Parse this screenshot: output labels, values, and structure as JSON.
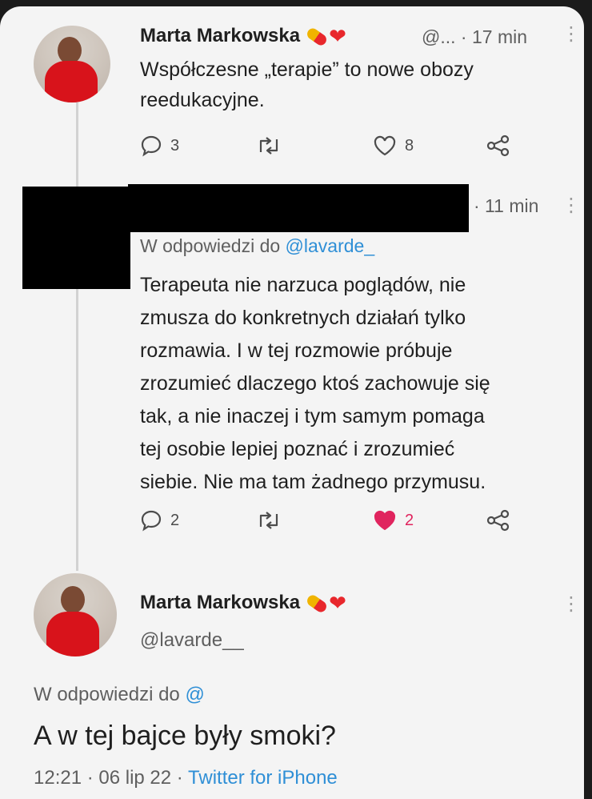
{
  "tweet1": {
    "name": "Marta Markowska",
    "handle_short": "@...",
    "time": "· 17 min",
    "text_line1": "Współczesne „terapie” to nowe obozy",
    "text_line2": "reedukacyjne.",
    "replies": "3",
    "likes": "8"
  },
  "tweet2": {
    "time": "· 11 min",
    "reply_prefix": "W odpowiedzi do ",
    "reply_handle": "@lavarde_",
    "lines": [
      "Terapeuta nie narzuca poglądów, nie",
      "zmusza do konkretnych działań tylko",
      "rozmawia. I w tej rozmowie próbuje",
      "zrozumieć dlaczego ktoś zachowuje się",
      "tak, a nie inaczej i tym samym pomaga",
      "tej osobie lepiej poznać i zrozumieć",
      "siebie. Nie ma tam żadnego przymusu."
    ],
    "replies": "2",
    "likes": "2",
    "liked_color": "#e0245e"
  },
  "tweet3": {
    "name": "Marta Markowska",
    "handle": "@lavarde__",
    "reply_prefix": "W odpowiedzi do ",
    "reply_handle": "@",
    "text": "A w tej bajce były smoki?",
    "time": "12:21 · 06 lip 22 · ",
    "source": "Twitter for iPhone"
  },
  "icons": {
    "reply": "reply-bubble-icon",
    "retweet": "retweet-icon",
    "like": "heart-icon",
    "share": "share-icon",
    "more": "more-vertical-icon"
  },
  "colors": {
    "link": "#2f8fd6",
    "like_active": "#e0245e"
  }
}
